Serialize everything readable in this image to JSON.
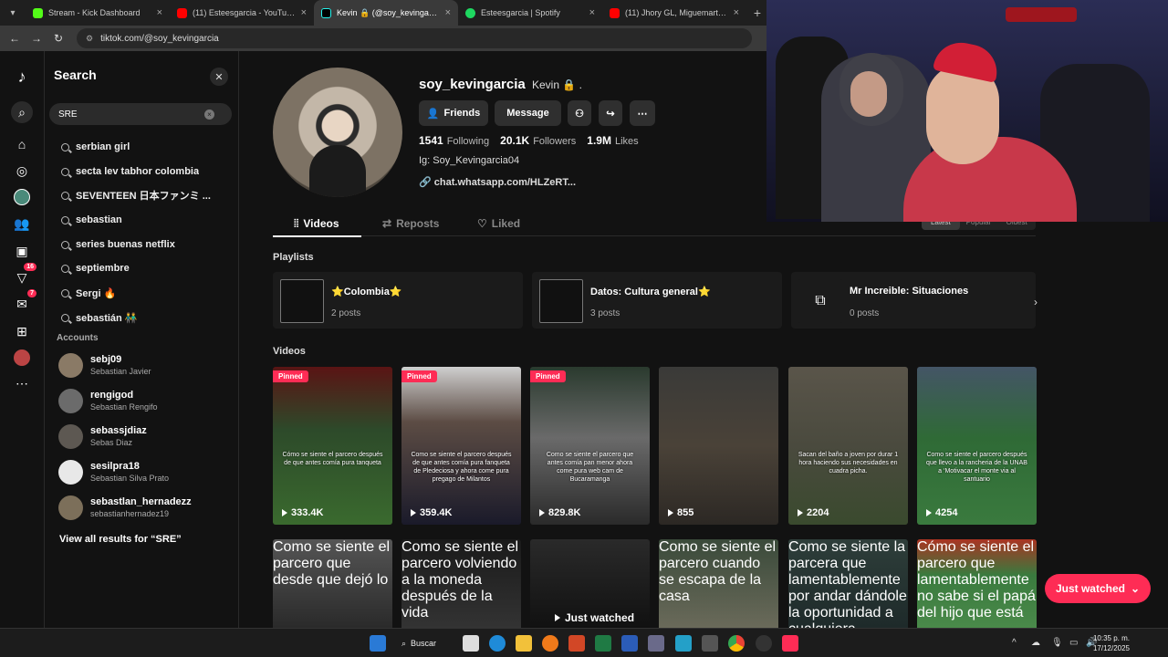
{
  "browser": {
    "tabs": [
      {
        "title": "Stream - Kick Dashboard",
        "icon": "kick-icon",
        "color": "#53fc18"
      },
      {
        "title": "(11) Esteesgarcia - YouTube",
        "icon": "youtube-icon",
        "color": "#ff0000"
      },
      {
        "title": "Kevin 🔒 (@soy_kevingarcia) |",
        "icon": "tiktok-icon",
        "color": "#ffffff"
      },
      {
        "title": "Esteesgarcia | Spotify",
        "icon": "spotify-icon",
        "color": "#1ed760"
      },
      {
        "title": "(11) Jhory GL, Miguemartinez",
        "icon": "youtube-icon",
        "color": "#ff0000"
      }
    ],
    "url": "tiktok.com/@soy_kevingarcia"
  },
  "search": {
    "title": "Search",
    "query": "SRE",
    "suggestions": [
      "serbian girl",
      "secta lev tabhor colombia",
      "SEVENTEEN 日本ファンミ ...",
      "sebastian",
      "series buenas netflix",
      "septiembre",
      "Sergi 🔥",
      "sebastián 👬"
    ],
    "accounts_header": "Accounts",
    "accounts": [
      {
        "username": "sebj09",
        "name": "Sebastian Javier",
        "color": "#8a7a66"
      },
      {
        "username": "rengigod",
        "name": "Sebastian Rengifo",
        "color": "#6b6b6b"
      },
      {
        "username": "sebassjdiaz",
        "name": "Sebas Diaz",
        "color": "#5d5852"
      },
      {
        "username": "sesilpra18",
        "name": "Sebastian Silva Prato",
        "color": "#e8e8e8"
      },
      {
        "username": "sebastlan_hernadezz",
        "name": "sebastianhernadez19",
        "color": "#7c6f5a"
      }
    ],
    "view_all": "View all results for “SRE”"
  },
  "rail": {
    "badges": {
      "activity": "16",
      "messages": "7"
    }
  },
  "profile": {
    "username": "soy_kevingarcia",
    "nickname": "Kevin 🔒 .",
    "buttons": {
      "friends": "Friends",
      "message": "Message"
    },
    "stats": [
      {
        "value": "1541",
        "label": "Following"
      },
      {
        "value": "20.1K",
        "label": "Followers"
      },
      {
        "value": "1.9M",
        "label": "Likes"
      }
    ],
    "bio": "Ig: Soy_Kevingarcia04",
    "link": "chat.whatsapp.com/HLZeRT...",
    "tabs": [
      "Videos",
      "Reposts",
      "Liked"
    ],
    "sort": [
      "Latest",
      "Popular",
      "Oldest"
    ],
    "playlists_title": "Playlists",
    "playlists": [
      {
        "name": "⭐Colombia⭐",
        "count": "2 posts"
      },
      {
        "name": "Datos: Cultura general⭐",
        "count": "3 posts"
      },
      {
        "name": "Mr Increible: Situaciones",
        "count": "0 posts"
      }
    ],
    "videos_title": "Videos",
    "pinned_label": "Pinned",
    "videos": [
      {
        "views": "333.4K",
        "pinned": true,
        "caption": "Cómo se siente el parcero después de que antes comía pura tanqueta",
        "bg": "#2d4a2a"
      },
      {
        "views": "359.4K",
        "pinned": true,
        "caption": "Como se siente el parcero después de que antes comía pura fanqueta de Pledeciosa y ahora come pura pregago de Milantos",
        "bg": "#1a1a2a"
      },
      {
        "views": "829.8K",
        "pinned": true,
        "caption": "Como se siente el parcero que antes comía pan menor ahora come pura web cam de Bucaramanga",
        "bg": "#3a3a3a"
      },
      {
        "views": "855",
        "pinned": false,
        "caption": "",
        "bg": "#4a4238"
      },
      {
        "views": "2204",
        "pinned": false,
        "caption": "Sacan del baño a joven por durar 1 hora haciendo sus necesidades en cuadra picha.",
        "bg": "#4a4a3e"
      },
      {
        "views": "4254",
        "pinned": false,
        "caption": "Como se siente el parcero después que llevo a la rancheria de la UNAB a ‘Motivacar el monte via al santuario",
        "bg": "#2f6a36"
      }
    ],
    "row2_captions": [
      "Como se siente el parcero que desde que dejó lo",
      "Como se siente el parcero volviendo a la moneda después de la vida",
      "",
      "Como se siente el parcero cuando se escapa de la casa",
      "Como se siente la parcera que lamentablemente por andar dándole la oportunidad a cualquiera",
      "Cómo se siente el parcero que lamentablemente no sabe si el papá del hijo que está"
    ],
    "just_watched": "Just watched"
  },
  "taskbar": {
    "search_label": "Buscar",
    "time": "10:35 p. m.",
    "date": "17/12/2025"
  }
}
